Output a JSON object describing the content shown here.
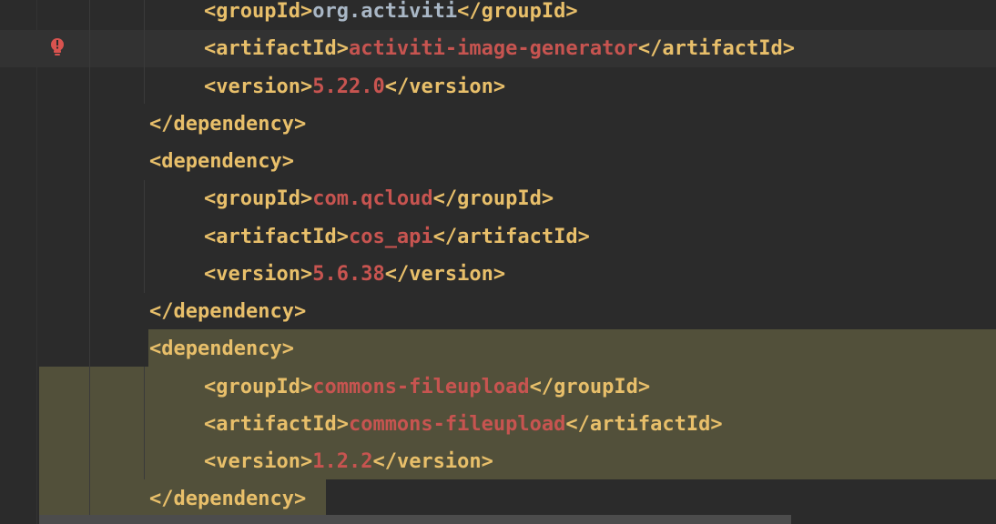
{
  "editor": {
    "lines": [
      {
        "open": "<groupId>",
        "value": "org.activiti",
        "close": "</groupId>",
        "value_style": "grey"
      },
      {
        "open": "<artifactId>",
        "value": "activiti-image-generator",
        "close": "</artifactId>",
        "value_style": "red"
      },
      {
        "open": "<version>",
        "value": "5.22.0",
        "close": "</version>",
        "value_style": "red"
      },
      {
        "open": "</dependency>",
        "value": "",
        "close": "",
        "value_style": "red"
      },
      {
        "open": "<dependency>",
        "value": "",
        "close": "",
        "value_style": "red"
      },
      {
        "open": "<groupId>",
        "value": "com.qcloud",
        "close": "</groupId>",
        "value_style": "red"
      },
      {
        "open": "<artifactId>",
        "value": "cos_api",
        "close": "</artifactId>",
        "value_style": "red"
      },
      {
        "open": "<version>",
        "value": "5.6.38",
        "close": "</version>",
        "value_style": "red"
      },
      {
        "open": "</dependency>",
        "value": "",
        "close": "",
        "value_style": "red"
      },
      {
        "open": "<dependency>",
        "value": "",
        "close": "",
        "value_style": "red"
      },
      {
        "open": "<groupId>",
        "value": "commons-fileupload",
        "close": "</groupId>",
        "value_style": "red"
      },
      {
        "open": "<artifactId>",
        "value": "commons-fileupload",
        "close": "</artifactId>",
        "value_style": "red"
      },
      {
        "open": "<version>",
        "value": "1.2.2",
        "close": "</version>",
        "value_style": "red"
      },
      {
        "open": "</dependency>",
        "value": "",
        "close": "",
        "value_style": "red"
      }
    ]
  },
  "colors": {
    "background": "#2b2b2b",
    "tag": "#e8bf6a",
    "value": "#c75450",
    "selection": "#52503a",
    "bulb": "#d9534f"
  },
  "icons": {
    "gutter_warning": "error-bulb-icon"
  }
}
